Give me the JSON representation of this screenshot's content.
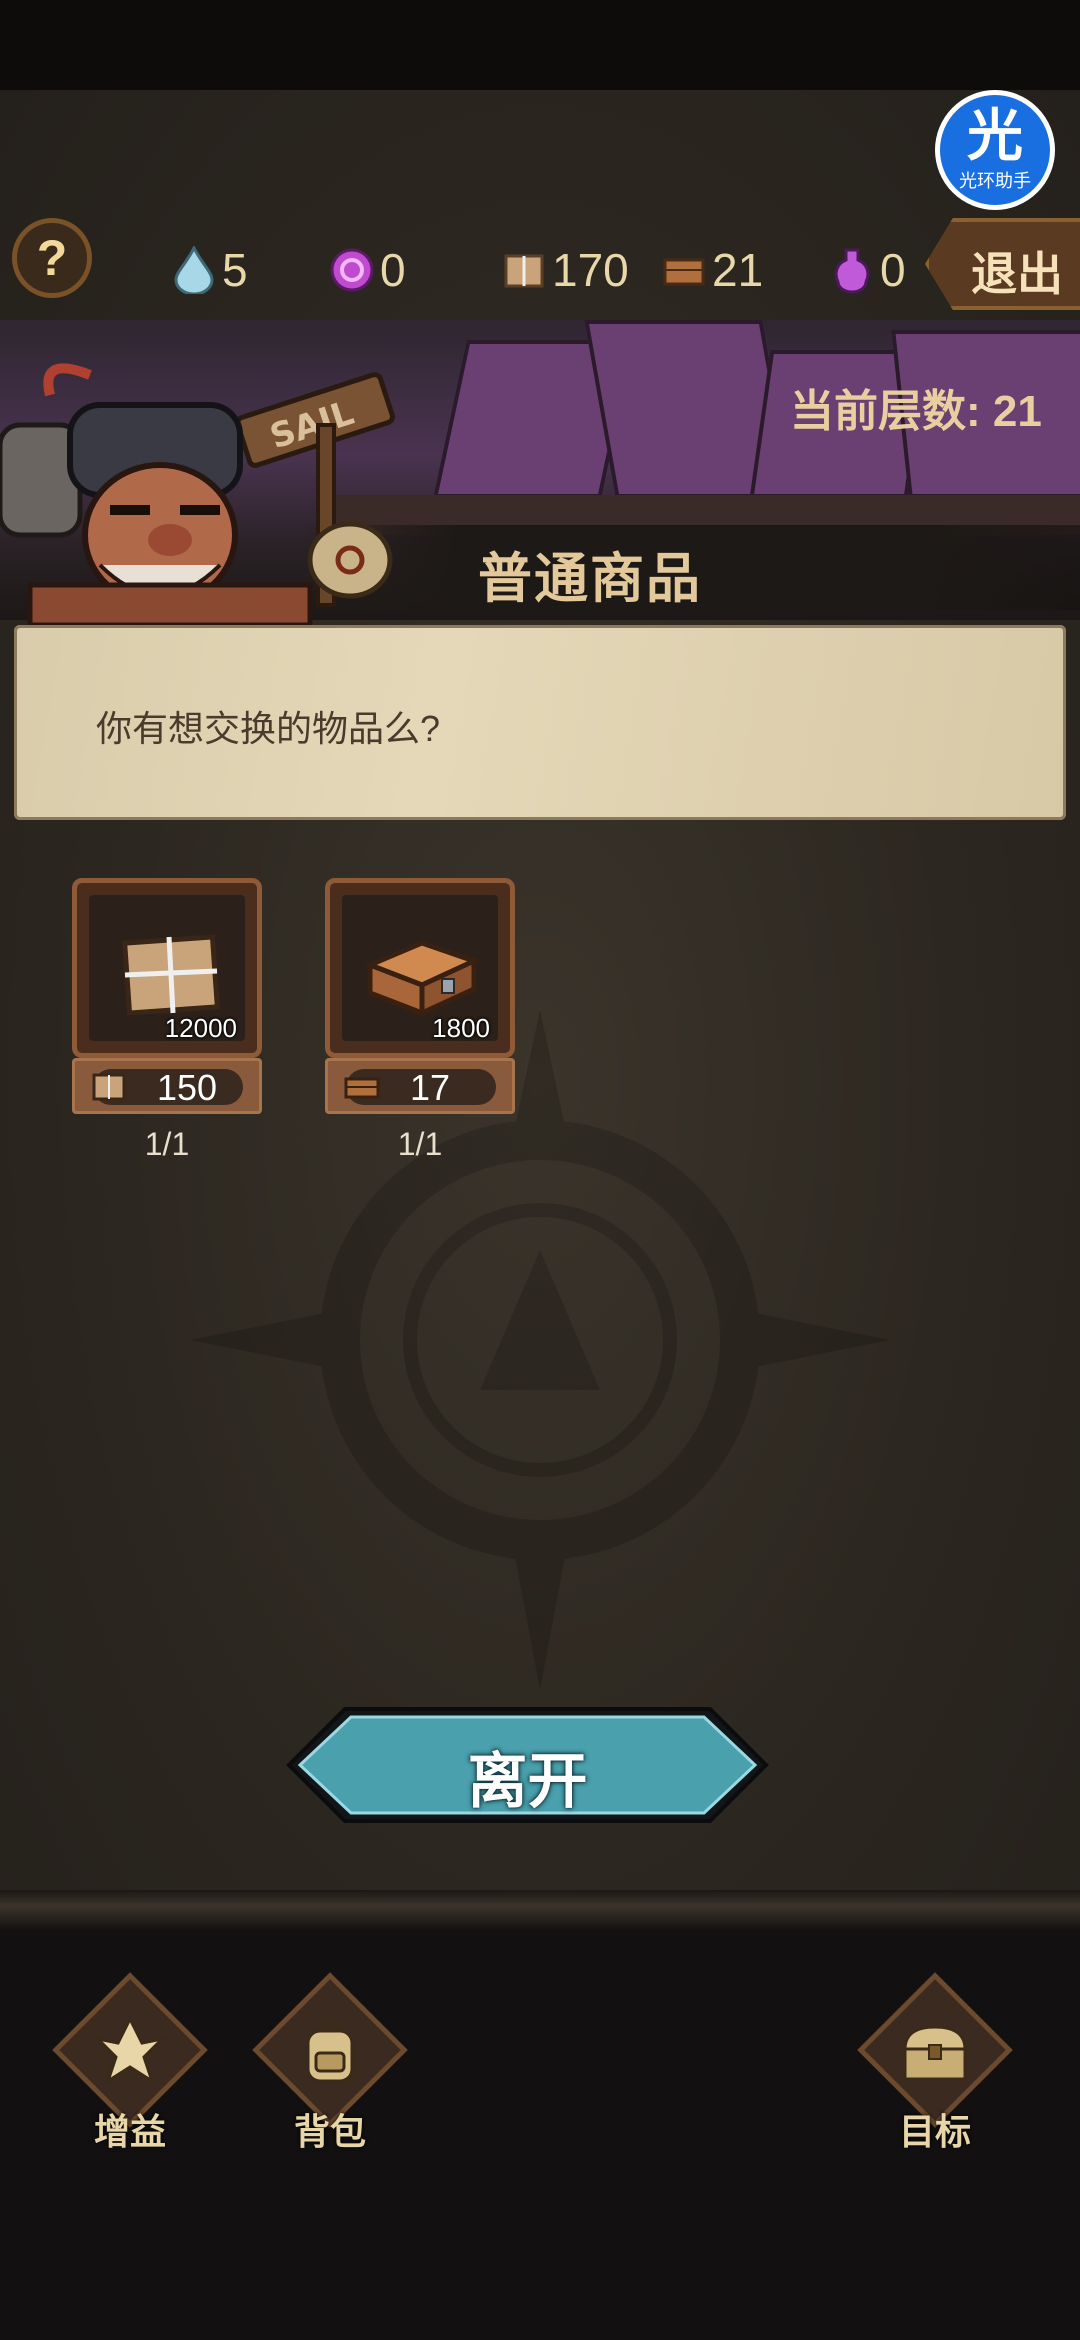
{
  "assistant": {
    "glyph": "光",
    "label": "光环助手"
  },
  "topbar": {
    "help_glyph": "?",
    "resources": [
      {
        "icon": "water-drop-icon",
        "value": "5"
      },
      {
        "icon": "purple-swirl-icon",
        "value": "0"
      },
      {
        "icon": "paper-package-icon",
        "value": "170"
      },
      {
        "icon": "wooden-crate-icon",
        "value": "21"
      },
      {
        "icon": "potion-icon",
        "value": "0"
      }
    ],
    "exit_label": "退出"
  },
  "scene": {
    "level_text": "当前层数: 21",
    "sign_text": "SAIL"
  },
  "shop": {
    "section_title": "普通商品",
    "dialog_text": "你有想交换的物品么?",
    "items": [
      {
        "icon": "paper-package-icon",
        "quantity": "12000",
        "price_icon": "paper-package-icon",
        "price": "150",
        "limit": "1/1"
      },
      {
        "icon": "wooden-crate-icon",
        "quantity": "1800",
        "price_icon": "wooden-crate-icon",
        "price": "17",
        "limit": "1/1"
      }
    ],
    "leave_label": "离开"
  },
  "bottom_nav": [
    {
      "icon": "buff-emblem-icon",
      "label": "增益"
    },
    {
      "icon": "backpack-icon",
      "label": "背包"
    },
    {
      "icon": "treasure-chest-icon",
      "label": "目标"
    }
  ],
  "colors": {
    "background": "#2a251f",
    "dialog": "#e0d3b2",
    "leave_button": "#4aa0ad",
    "rocks": "#6a3f72"
  }
}
